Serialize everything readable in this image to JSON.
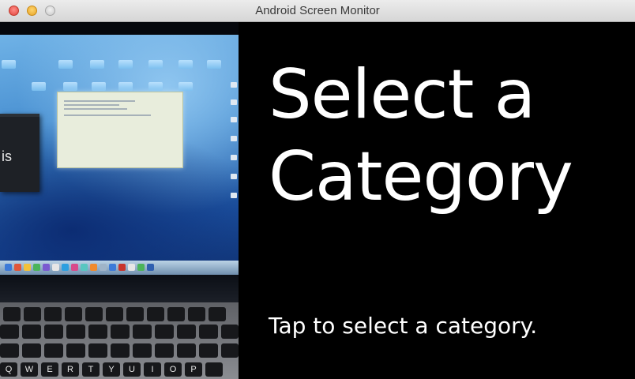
{
  "window": {
    "title": "Android Screen Monitor"
  },
  "feed": {
    "partial_window_text": "is",
    "keyboard_keys": [
      "Q",
      "W",
      "E",
      "R",
      "T",
      "Y",
      "U",
      "I",
      "O",
      "P"
    ]
  },
  "card": {
    "heading_line1": "Select a",
    "heading_line2": "Category",
    "footer": "Tap to select a category."
  },
  "colors": {
    "card_background": "#000000",
    "card_text": "#ffffff",
    "titlebar": "#e3e3e3"
  }
}
